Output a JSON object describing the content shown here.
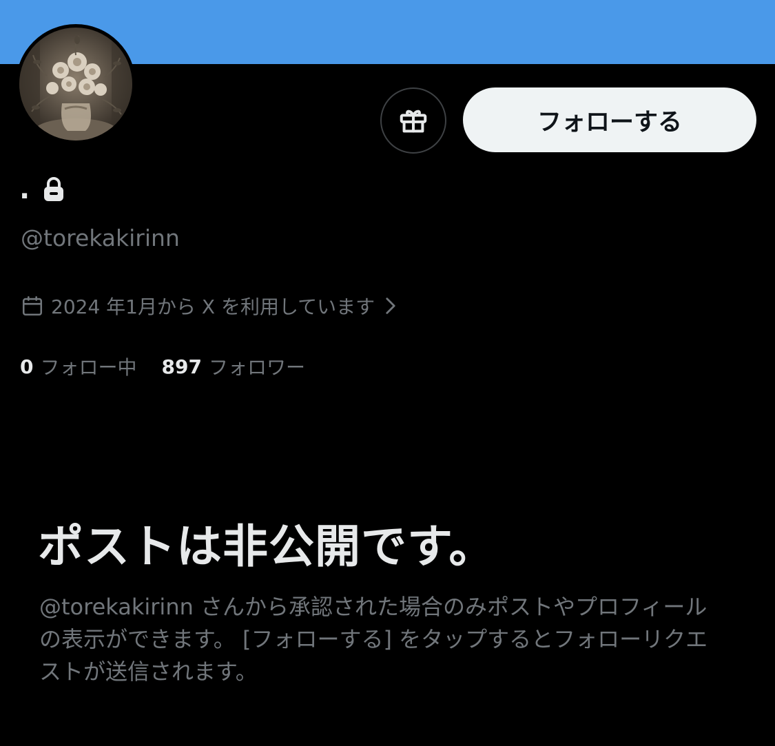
{
  "colors": {
    "banner": "#4a99e9",
    "background": "#000000",
    "primary_text": "#e7e9ea",
    "secondary_text": "#71767b",
    "follow_button_bg": "#eff3f4"
  },
  "profile": {
    "avatar_icon": "bouquet-photo",
    "display_name": ".",
    "protected_icon": "lock-icon",
    "handle": "@torekakirinn",
    "joined_text": "2024 年1月から X を利用しています",
    "joined_icon": "calendar-icon",
    "joined_chevron": "chevron-right-icon"
  },
  "actions": {
    "gift_icon": "gift-icon",
    "follow_label": "フォローする"
  },
  "stats": {
    "following_count": "0",
    "following_label": "フォロー中",
    "followers_count": "897",
    "followers_label": "フォロワー"
  },
  "private_notice": {
    "title": "ポストは非公開です。",
    "description": "@torekakirinn さんから承認された場合のみポストやプロフィールの表示ができます。 [フォローする] をタップするとフォローリクエストが送信されます。"
  }
}
